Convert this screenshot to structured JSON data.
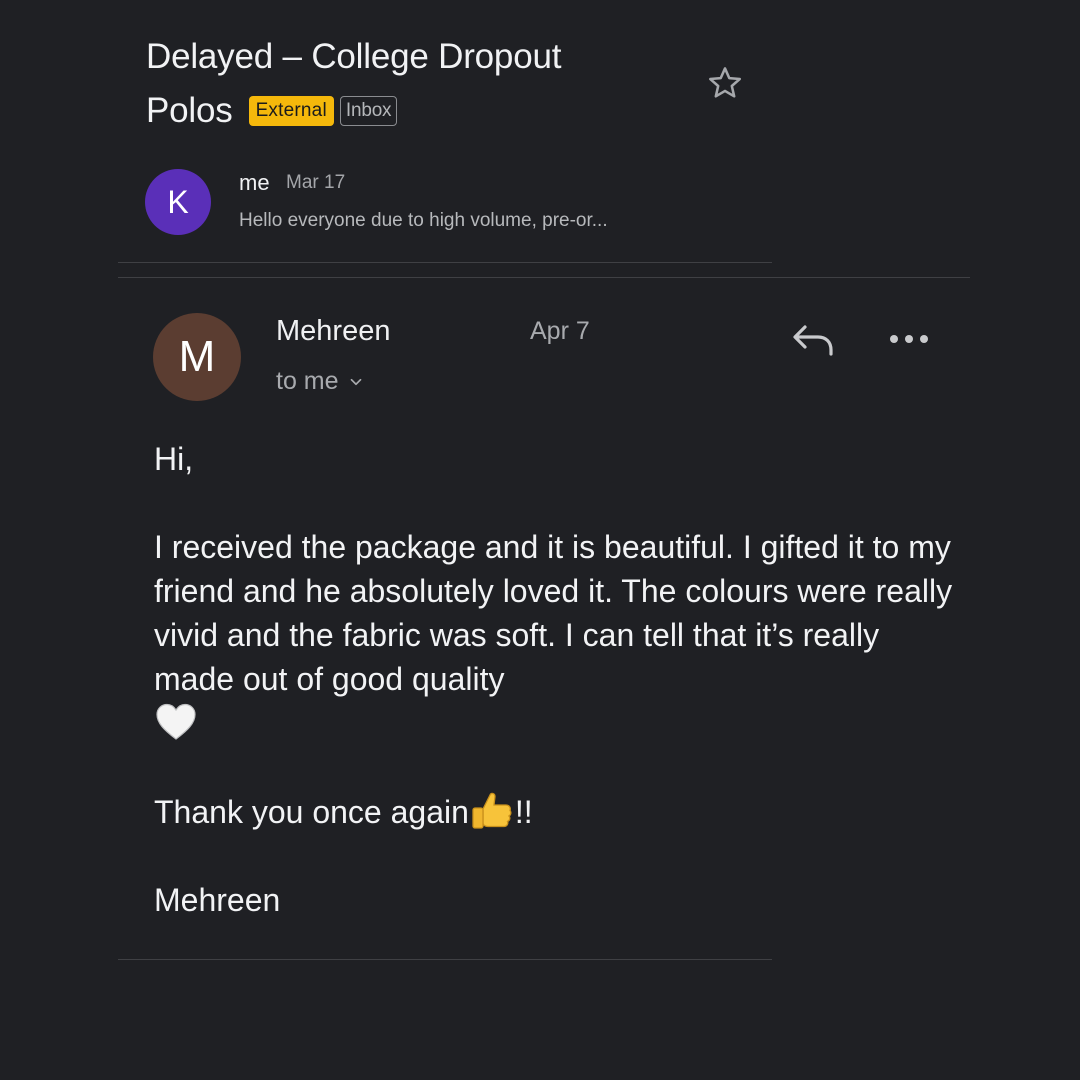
{
  "thread": {
    "subject_line1": "Delayed – College Dropout",
    "subject_line2": "Polos",
    "labels": {
      "external": "External",
      "inbox": "Inbox"
    },
    "colors": {
      "external_bg": "#f5b80b",
      "background": "#1f2024"
    }
  },
  "collapsed_message": {
    "avatar_letter": "K",
    "avatar_color": "#5a2fb8",
    "sender": "me",
    "date": "Mar 17",
    "snippet": "Hello everyone due to high volume, pre-or..."
  },
  "open_message": {
    "avatar_letter": "M",
    "avatar_color": "#5b3d31",
    "sender": "Mehreen",
    "date": "Apr 7",
    "recipient": "to me",
    "icons": [
      "reply-icon",
      "more-icon",
      "star-icon",
      "chevron-down-icon"
    ],
    "body": {
      "greeting": "Hi,",
      "paragraph": "I received the package and it is beautiful. I gifted it to my friend and he absolutely loved it. The colours were really vivid and the fabric was soft. I can tell that it’s really made out of good quality",
      "heart_emoji": "🤍",
      "thanks_text": "Thank you once again",
      "thumbs_emoji": "👍",
      "thanks_suffix": "!!",
      "signature": "Mehreen"
    }
  }
}
